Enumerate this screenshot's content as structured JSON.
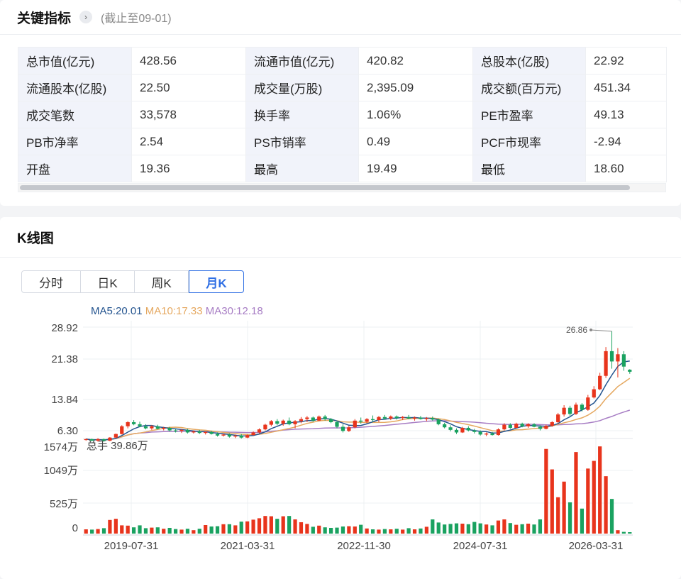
{
  "indicators": {
    "title": "关键指标",
    "as_of": "(截止至09-01)",
    "rows": [
      [
        [
          "总市值(亿元)",
          "428.56"
        ],
        [
          "流通市值(亿元)",
          "420.82"
        ],
        [
          "总股本(亿股)",
          "22.92"
        ]
      ],
      [
        [
          "流通股本(亿股)",
          "22.50"
        ],
        [
          "成交量(万股)",
          "2,395.09"
        ],
        [
          "成交额(百万元)",
          "451.34"
        ]
      ],
      [
        [
          "成交笔数",
          "33,578"
        ],
        [
          "换手率",
          "1.06%"
        ],
        [
          "PE市盈率",
          "49.13"
        ]
      ],
      [
        [
          "PB市净率",
          "2.54"
        ],
        [
          "PS市销率",
          "0.49"
        ],
        [
          "PCF市现率",
          "-2.94"
        ]
      ],
      [
        [
          "开盘",
          "19.36"
        ],
        [
          "最高",
          "19.49"
        ],
        [
          "最低",
          "18.60"
        ]
      ]
    ]
  },
  "kline": {
    "title": "K线图",
    "tabs": [
      "分时",
      "日K",
      "周K",
      "月K"
    ],
    "active_tab": "月K",
    "ma5_label": "MA5:20.01",
    "ma10_label": "MA10:17.33",
    "ma30_label": "MA30:12.18",
    "colors": {
      "up": "#e8341c",
      "down": "#1aa260",
      "ma5": "#24548f",
      "ma10": "#e5a860",
      "ma30": "#a77dc4"
    },
    "price_ticks": [
      "28.92",
      "21.38",
      "13.84",
      "6.30"
    ],
    "price_range": [
      6.3,
      28.92
    ],
    "max_marker": "26.86",
    "volume_label": "总手 39.86万",
    "volume_ticks": [
      "1574万",
      "1049万",
      "525万",
      "0"
    ],
    "volume_max": 1574,
    "x_ticks": [
      "2019-07-31",
      "2021-03-31",
      "2022-11-30",
      "2024-07-31",
      "2026-03-31"
    ]
  },
  "chart_data": {
    "type": "candlestick",
    "title": "K线图",
    "x_labels": [
      "2019-07-31",
      "2021-03-31",
      "2022-11-30",
      "2024-07-31",
      "2026-03-31"
    ],
    "y_range": [
      6.3,
      28.92
    ],
    "volume_range": [
      0,
      1574
    ],
    "ohlc": [
      [
        5.8,
        6.0,
        5.6,
        5.9
      ],
      [
        5.9,
        6.0,
        5.5,
        5.6
      ],
      [
        5.6,
        6.1,
        5.4,
        5.9
      ],
      [
        5.9,
        6.0,
        5.4,
        5.6
      ],
      [
        5.6,
        6.3,
        5.5,
        6.2
      ],
      [
        6.2,
        7.0,
        6.1,
        6.9
      ],
      [
        6.9,
        8.6,
        6.8,
        8.4
      ],
      [
        8.4,
        9.4,
        8.0,
        9.2
      ],
      [
        9.2,
        9.6,
        8.6,
        8.8
      ],
      [
        8.8,
        9.3,
        8.2,
        8.4
      ],
      [
        8.4,
        8.8,
        7.8,
        8.0
      ],
      [
        8.0,
        8.6,
        7.7,
        8.4
      ],
      [
        8.4,
        8.7,
        7.8,
        7.9
      ],
      [
        7.9,
        8.3,
        7.6,
        8.1
      ],
      [
        8.1,
        8.3,
        7.4,
        7.6
      ],
      [
        7.6,
        7.9,
        7.2,
        7.5
      ],
      [
        7.5,
        7.9,
        7.1,
        7.7
      ],
      [
        7.7,
        7.9,
        7.0,
        7.2
      ],
      [
        7.2,
        7.6,
        7.0,
        7.4
      ],
      [
        7.4,
        7.7,
        6.9,
        7.1
      ],
      [
        7.1,
        7.4,
        6.8,
        7.3
      ],
      [
        7.3,
        7.5,
        6.8,
        6.9
      ],
      [
        6.9,
        7.2,
        6.4,
        6.6
      ],
      [
        6.6,
        7.0,
        6.4,
        6.8
      ],
      [
        6.8,
        7.0,
        6.2,
        6.4
      ],
      [
        6.4,
        6.8,
        6.1,
        6.6
      ],
      [
        6.6,
        6.9,
        6.0,
        6.2
      ],
      [
        6.2,
        6.8,
        6.1,
        6.7
      ],
      [
        6.7,
        7.4,
        6.6,
        7.2
      ],
      [
        7.2,
        8.0,
        7.0,
        7.8
      ],
      [
        7.8,
        8.9,
        7.6,
        8.7
      ],
      [
        8.7,
        9.6,
        8.4,
        9.4
      ],
      [
        9.4,
        9.8,
        8.6,
        8.9
      ],
      [
        8.9,
        9.7,
        8.5,
        9.5
      ],
      [
        9.5,
        10.1,
        8.6,
        8.8
      ],
      [
        8.8,
        9.6,
        8.0,
        9.4
      ],
      [
        9.4,
        10.2,
        9.0,
        9.8
      ],
      [
        9.8,
        10.4,
        9.2,
        10.1
      ],
      [
        10.1,
        10.3,
        9.3,
        9.5
      ],
      [
        9.5,
        10.5,
        9.4,
        10.3
      ],
      [
        10.3,
        10.6,
        9.5,
        9.8
      ],
      [
        9.8,
        10.0,
        9.0,
        9.2
      ],
      [
        9.2,
        9.5,
        8.0,
        8.3
      ],
      [
        8.3,
        8.8,
        7.2,
        7.5
      ],
      [
        7.5,
        8.5,
        7.3,
        8.2
      ],
      [
        8.2,
        9.8,
        8.0,
        9.5
      ],
      [
        9.5,
        10.1,
        8.9,
        9.3
      ],
      [
        9.3,
        10.0,
        9.0,
        9.8
      ],
      [
        9.8,
        10.5,
        9.3,
        9.6
      ],
      [
        9.6,
        10.4,
        9.2,
        10.2
      ],
      [
        10.2,
        10.6,
        9.7,
        9.9
      ],
      [
        9.9,
        10.5,
        9.6,
        10.3
      ],
      [
        10.3,
        10.5,
        9.7,
        10.0
      ],
      [
        10.0,
        10.4,
        9.6,
        10.2
      ],
      [
        10.2,
        10.6,
        9.8,
        9.9
      ],
      [
        9.9,
        10.3,
        9.5,
        10.1
      ],
      [
        10.1,
        10.4,
        9.7,
        9.8
      ],
      [
        9.8,
        10.2,
        9.4,
        10.0
      ],
      [
        10.0,
        10.3,
        9.5,
        9.7
      ],
      [
        9.7,
        9.9,
        8.6,
        8.8
      ],
      [
        8.8,
        9.1,
        8.0,
        8.2
      ],
      [
        8.2,
        8.6,
        7.4,
        7.7
      ],
      [
        7.7,
        8.0,
        6.9,
        7.2
      ],
      [
        7.2,
        8.3,
        7.1,
        8.1
      ],
      [
        8.1,
        8.4,
        7.4,
        7.6
      ],
      [
        7.6,
        7.9,
        7.0,
        7.3
      ],
      [
        7.3,
        7.6,
        6.6,
        6.8
      ],
      [
        6.8,
        7.2,
        6.5,
        7.0
      ],
      [
        7.0,
        7.3,
        6.6,
        6.7
      ],
      [
        6.7,
        8.0,
        6.6,
        7.8
      ],
      [
        7.8,
        9.0,
        7.6,
        8.7
      ],
      [
        8.7,
        9.0,
        7.9,
        8.1
      ],
      [
        8.1,
        9.1,
        8.0,
        8.9
      ],
      [
        8.9,
        9.1,
        8.2,
        8.4
      ],
      [
        8.4,
        9.0,
        8.1,
        8.8
      ],
      [
        8.8,
        9.0,
        8.2,
        8.3
      ],
      [
        8.3,
        8.6,
        7.6,
        7.9
      ],
      [
        7.9,
        8.7,
        7.8,
        8.5
      ],
      [
        8.5,
        9.4,
        8.3,
        9.2
      ],
      [
        9.2,
        11.0,
        9.0,
        10.7
      ],
      [
        10.7,
        12.5,
        10.3,
        12.0
      ],
      [
        12.0,
        12.4,
        10.4,
        10.8
      ],
      [
        10.8,
        13.0,
        10.6,
        12.6
      ],
      [
        12.6,
        12.9,
        11.3,
        11.6
      ],
      [
        11.6,
        14.5,
        11.4,
        14.0
      ],
      [
        14.0,
        16.2,
        13.8,
        15.6
      ],
      [
        15.6,
        18.8,
        15.4,
        18.2
      ],
      [
        18.2,
        23.8,
        17.8,
        23.0
      ],
      [
        23.0,
        26.86,
        19.6,
        21.0
      ],
      [
        21.0,
        23.6,
        17.9,
        22.4
      ],
      [
        22.4,
        23.0,
        19.2,
        20.0
      ],
      [
        19.4,
        19.5,
        18.6,
        19.0
      ]
    ],
    "volume": [
      75,
      70,
      80,
      95,
      240,
      260,
      145,
      140,
      110,
      145,
      95,
      105,
      110,
      85,
      100,
      80,
      70,
      85,
      60,
      85,
      150,
      125,
      130,
      165,
      165,
      145,
      210,
      215,
      245,
      270,
      310,
      305,
      260,
      305,
      310,
      250,
      200,
      170,
      120,
      140,
      110,
      100,
      105,
      125,
      130,
      125,
      155,
      90,
      75,
      70,
      80,
      75,
      85,
      70,
      95,
      75,
      90,
      120,
      250,
      195,
      160,
      170,
      180,
      175,
      165,
      205,
      180,
      160,
      145,
      230,
      250,
      185,
      155,
      165,
      175,
      160,
      250,
      1490,
      1130,
      640,
      915,
      550,
      1435,
      440,
      1145,
      1280,
      1535,
      1010,
      610,
      60,
      30,
      25
    ],
    "ma5": [],
    "ma10": [],
    "ma30": []
  }
}
